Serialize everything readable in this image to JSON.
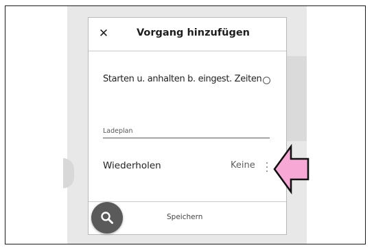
{
  "dialog": {
    "title": "Vorgang hinzufügen",
    "close_icon": "close-icon",
    "start_stop_label": "Starten u. anhalten b. eingest. Zeiten",
    "charge_plan_placeholder": "Ladeplan",
    "charge_plan_value": "",
    "repeat_label": "Wiederholen",
    "repeat_value": "Keine",
    "save_label": "Speichern"
  },
  "fab": {
    "icon": "search-icon"
  },
  "annotation": {
    "icon": "pink-arrow-icon",
    "color": "#f7a8d5"
  },
  "colors": {
    "dialog_bg": "#ffffff",
    "backdrop": "#e8e8e8",
    "fab": "#5a5a5a"
  }
}
